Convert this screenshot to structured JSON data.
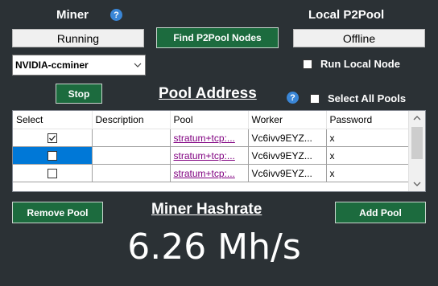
{
  "miner": {
    "heading": "Miner",
    "help_glyph": "?",
    "status": "Running",
    "device": "NVIDIA-ccminer",
    "stop_label": "Stop"
  },
  "find_nodes_label": "Find P2Pool Nodes",
  "local_p2pool": {
    "heading": "Local P2Pool",
    "status": "Offline",
    "run_local_label": "Run Local Node"
  },
  "pool_address": {
    "heading": "Pool Address",
    "help_glyph": "?",
    "select_all_label": "Select All Pools"
  },
  "grid": {
    "columns": [
      "Select",
      "Description",
      "Pool",
      "Worker",
      "Password"
    ],
    "rows": [
      {
        "checked": true,
        "description": "",
        "pool": "stratum+tcp:...",
        "worker": "Vc6ivv9EYZ...",
        "password": "x"
      },
      {
        "checked": false,
        "description": "",
        "pool": "stratum+tcp:...",
        "worker": "Vc6ivv9EYZ...",
        "password": "x"
      },
      {
        "checked": false,
        "description": "",
        "pool": "stratum+tcp:...",
        "worker": "Vc6ivv9EYZ...",
        "password": "x"
      }
    ]
  },
  "remove_pool_label": "Remove Pool",
  "add_pool_label": "Add Pool",
  "hashrate": {
    "heading": "Miner Hashrate",
    "value": "6.26 Mh/s"
  },
  "colors": {
    "background": "#2b3135",
    "button_green": "#1c6b3e",
    "help_blue": "#3a86d6",
    "selection_blue": "#0078d7",
    "link_purple": "#800080"
  }
}
